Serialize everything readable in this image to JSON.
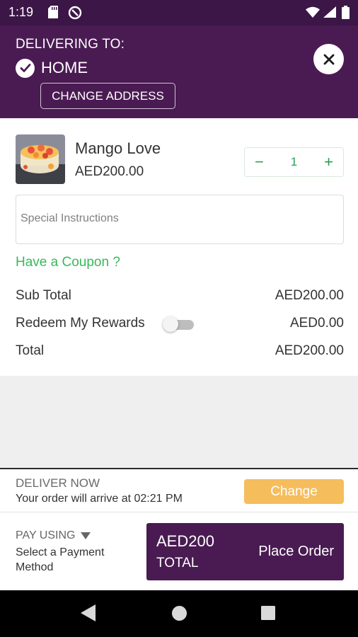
{
  "status_bar": {
    "time": "1:19"
  },
  "header": {
    "delivering_label": "DELIVERING TO:",
    "address_name": "HOME",
    "change_address_label": "CHANGE ADDRESS"
  },
  "cart": {
    "item": {
      "name": "Mango Love",
      "price": "AED200.00",
      "quantity": "1"
    },
    "instructions_placeholder": "Special Instructions",
    "coupon_label": "Have a Coupon ?"
  },
  "summary": {
    "subtotal_label": "Sub Total",
    "subtotal_value": "AED200.00",
    "rewards_label": "Redeem My Rewards",
    "rewards_value": "AED0.00",
    "rewards_enabled": false,
    "total_label": "Total",
    "total_value": "AED200.00"
  },
  "delivery": {
    "title": "DELIVER NOW",
    "eta": "Your order will arrive at 02:21 PM",
    "change_label": "Change"
  },
  "payment": {
    "pay_using_label": "PAY USING",
    "method_placeholder": "Select a Payment Method"
  },
  "order": {
    "amount": "AED200",
    "total_label": "TOTAL",
    "place_label": "Place Order"
  },
  "colors": {
    "brand": "#4a1b52",
    "accent_green": "#27a04d",
    "change_button": "#f6bd5c"
  }
}
